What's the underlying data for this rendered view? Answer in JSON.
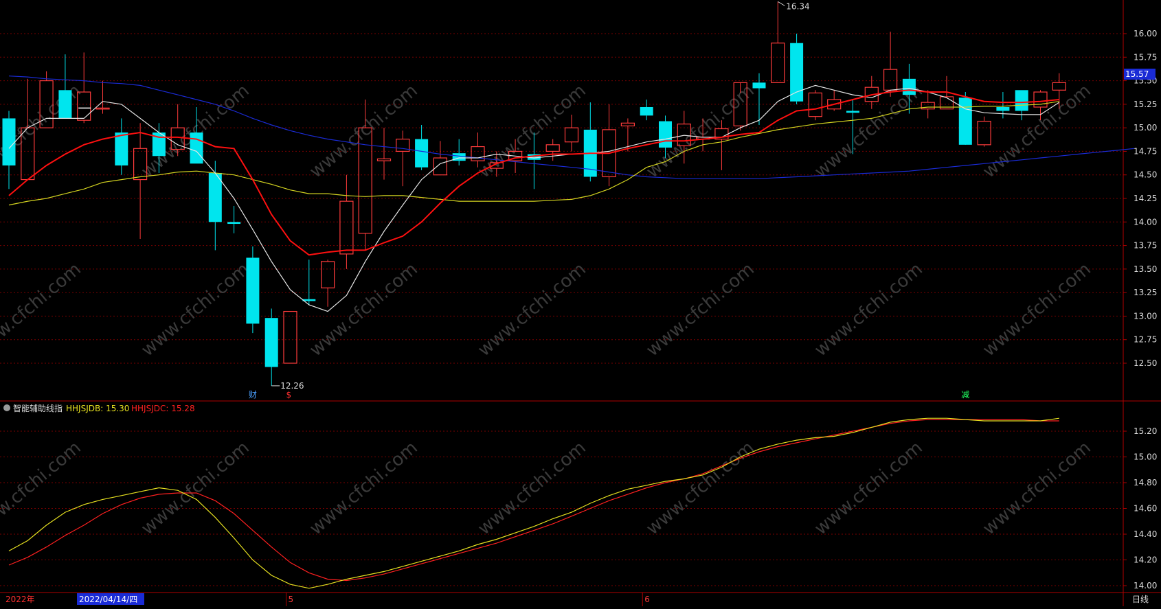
{
  "colors": {
    "background": "#000000",
    "grid": "#7a0000",
    "axis": "#b00000",
    "up": "#ff3b3b",
    "down": "#00e5ee",
    "ma5": "#e6e6e6",
    "ma10": "#ff1010",
    "ma20": "#d4d420",
    "ma60": "#1a2bd6",
    "sub_db": "#e6e020",
    "sub_dc": "#ff2020",
    "label_text": "#dcdcdc",
    "price_tag_bg": "#1a2bd6"
  },
  "price_panel": {
    "last_price_tag": "15.57",
    "high_label": "16.34",
    "low_label": "12.26",
    "markers": [
      {
        "text": "财",
        "color": "#4aa0ff",
        "index": 13
      },
      {
        "text": "$",
        "color": "#ff3030",
        "index": 15
      },
      {
        "text": "减",
        "color": "#20ff60",
        "index": 51
      }
    ]
  },
  "indicator": {
    "name": "智能辅助线指",
    "line1_label": "HHJSJDB: 15.30",
    "line2_label": "HHJSJDC: 15.28"
  },
  "bottom_axis": {
    "year_label": "2022年",
    "cursor_date": "2022/04/14/四",
    "month_labels": [
      {
        "text": "5",
        "index": 15
      },
      {
        "text": "6",
        "index": 34
      }
    ],
    "period_button": "日线"
  },
  "chart_data": [
    {
      "type": "candlestick",
      "ylim": [
        12.1,
        16.4
      ],
      "y_ticks": [
        "16.00",
        "15.75",
        "15.50",
        "15.25",
        "15.00",
        "14.75",
        "14.50",
        "14.25",
        "14.00",
        "13.75",
        "13.50",
        "13.25",
        "13.00",
        "12.75",
        "12.50"
      ],
      "ohlc": [
        [
          15.1,
          15.18,
          14.35,
          14.6
        ],
        [
          14.45,
          15.52,
          14.45,
          15.0
        ],
        [
          15.0,
          15.6,
          15.0,
          15.5
        ],
        [
          15.4,
          15.78,
          15.4,
          15.1
        ],
        [
          15.08,
          15.8,
          15.05,
          15.38
        ],
        [
          15.2,
          15.5,
          15.15,
          15.21
        ],
        [
          14.95,
          15.1,
          14.5,
          14.6
        ],
        [
          14.45,
          15.05,
          13.82,
          14.78
        ],
        [
          14.95,
          15.05,
          14.52,
          14.7
        ],
        [
          14.77,
          15.25,
          14.7,
          15.0
        ],
        [
          14.95,
          15.22,
          14.62,
          14.62
        ],
        [
          14.52,
          14.65,
          13.7,
          14.0
        ],
        [
          14.0,
          14.17,
          13.88,
          13.98
        ],
        [
          13.62,
          13.74,
          12.82,
          12.92
        ],
        [
          12.98,
          13.08,
          12.26,
          12.46
        ],
        [
          12.5,
          13.05,
          12.5,
          13.05
        ],
        [
          13.18,
          13.6,
          13.12,
          13.16
        ],
        [
          13.3,
          13.6,
          13.1,
          13.58
        ],
        [
          13.66,
          14.5,
          13.5,
          14.22
        ],
        [
          13.88,
          15.3,
          13.7,
          15.0
        ],
        [
          14.65,
          15.0,
          14.45,
          14.67
        ],
        [
          14.75,
          14.97,
          14.38,
          14.88
        ],
        [
          14.88,
          15.03,
          14.55,
          14.58
        ],
        [
          14.5,
          14.86,
          14.5,
          14.68
        ],
        [
          14.73,
          14.88,
          14.6,
          14.65
        ],
        [
          14.65,
          14.95,
          14.58,
          14.8
        ],
        [
          14.57,
          14.75,
          14.48,
          14.63
        ],
        [
          14.65,
          14.88,
          14.52,
          14.75
        ],
        [
          14.72,
          14.95,
          14.35,
          14.66
        ],
        [
          14.75,
          14.88,
          14.65,
          14.82
        ],
        [
          14.85,
          15.14,
          14.75,
          15.0
        ],
        [
          14.98,
          15.27,
          14.43,
          14.48
        ],
        [
          14.48,
          15.25,
          14.38,
          14.98
        ],
        [
          15.02,
          15.1,
          14.75,
          15.05
        ],
        [
          15.22,
          15.3,
          15.08,
          15.13
        ],
        [
          15.07,
          15.13,
          14.68,
          14.79
        ],
        [
          14.81,
          15.18,
          14.62,
          15.04
        ],
        [
          14.88,
          15.1,
          14.75,
          14.9
        ],
        [
          14.88,
          15.08,
          14.55,
          14.99
        ],
        [
          15.02,
          15.37,
          14.97,
          15.48
        ],
        [
          15.48,
          15.58,
          15.03,
          15.42
        ],
        [
          15.48,
          16.34,
          15.48,
          15.9
        ],
        [
          15.9,
          16.0,
          15.25,
          15.28
        ],
        [
          15.12,
          15.4,
          15.08,
          15.37
        ],
        [
          15.2,
          15.4,
          15.18,
          15.3
        ],
        [
          15.18,
          15.3,
          14.72,
          15.16
        ],
        [
          15.28,
          15.55,
          15.2,
          15.43
        ],
        [
          15.4,
          16.02,
          15.33,
          15.62
        ],
        [
          15.52,
          15.68,
          15.15,
          15.35
        ],
        [
          15.2,
          15.4,
          15.1,
          15.27
        ],
        [
          15.2,
          15.55,
          15.2,
          15.33
        ],
        [
          15.32,
          15.38,
          14.83,
          14.82
        ],
        [
          14.82,
          15.12,
          14.8,
          15.07
        ],
        [
          15.22,
          15.38,
          15.1,
          15.18
        ],
        [
          15.4,
          15.4,
          15.08,
          15.18
        ],
        [
          15.22,
          15.4,
          15.08,
          15.38
        ],
        [
          15.4,
          15.58,
          15.2,
          15.48
        ]
      ],
      "ma5": [
        14.78,
        15.0,
        15.1,
        15.1,
        15.1,
        15.28,
        15.25,
        15.1,
        14.95,
        14.82,
        14.75,
        14.52,
        14.25,
        13.92,
        13.58,
        13.28,
        13.12,
        13.05,
        13.22,
        13.58,
        13.9,
        14.18,
        14.45,
        14.62,
        14.68,
        14.68,
        14.72,
        14.7,
        14.68,
        14.7,
        14.72,
        14.73,
        14.75,
        14.8,
        14.85,
        14.88,
        14.92,
        14.9,
        14.9,
        15.0,
        15.08,
        15.28,
        15.38,
        15.45,
        15.4,
        15.35,
        15.32,
        15.4,
        15.42,
        15.38,
        15.32,
        15.2,
        15.16,
        15.15,
        15.14,
        15.14,
        15.27
      ],
      "ma10": [
        14.28,
        14.45,
        14.6,
        14.72,
        14.82,
        14.88,
        14.92,
        14.95,
        14.9,
        14.9,
        14.88,
        14.8,
        14.78,
        14.45,
        14.08,
        13.8,
        13.65,
        13.68,
        13.7,
        13.7,
        13.78,
        13.85,
        14.0,
        14.2,
        14.38,
        14.52,
        14.62,
        14.68,
        14.7,
        14.72,
        14.72,
        14.73,
        14.73,
        14.78,
        14.82,
        14.86,
        14.86,
        14.88,
        14.9,
        14.93,
        14.95,
        15.08,
        15.18,
        15.2,
        15.25,
        15.3,
        15.35,
        15.38,
        15.4,
        15.38,
        15.38,
        15.33,
        15.28,
        15.27,
        15.27,
        15.28,
        15.3
      ],
      "ma20": [
        14.18,
        14.22,
        14.25,
        14.3,
        14.35,
        14.42,
        14.45,
        14.48,
        14.5,
        14.53,
        14.54,
        14.52,
        14.5,
        14.45,
        14.4,
        14.34,
        14.3,
        14.3,
        14.28,
        14.27,
        14.28,
        14.28,
        14.26,
        14.24,
        14.22,
        14.22,
        14.22,
        14.22,
        14.22,
        14.23,
        14.24,
        14.28,
        14.35,
        14.45,
        14.58,
        14.64,
        14.75,
        14.82,
        14.85,
        14.9,
        14.94,
        14.98,
        15.01,
        15.04,
        15.06,
        15.08,
        15.1,
        15.15,
        15.2,
        15.22,
        15.22,
        15.22,
        15.23,
        15.23,
        15.24,
        15.25,
        15.28
      ],
      "ma60": [
        15.55,
        15.54,
        15.52,
        15.51,
        15.5,
        15.48,
        15.47,
        15.45,
        15.4,
        15.35,
        15.3,
        15.25,
        15.18,
        15.1,
        15.03,
        14.97,
        14.92,
        14.88,
        14.85,
        14.82,
        14.8,
        14.78,
        14.75,
        14.72,
        14.7,
        14.68,
        14.66,
        14.64,
        14.62,
        14.6,
        14.58,
        14.56,
        14.53,
        14.5,
        14.48,
        14.47,
        14.46,
        14.46,
        14.46,
        14.46,
        14.46,
        14.47,
        14.48,
        14.49,
        14.5,
        14.51,
        14.52,
        14.53,
        14.54,
        14.56,
        14.58,
        14.6,
        14.62,
        14.64,
        14.66,
        14.68,
        14.7,
        14.72,
        14.74,
        14.76,
        14.78
      ]
    },
    {
      "type": "line",
      "title": "智能辅助线指",
      "ylim": [
        13.96,
        15.36
      ],
      "y_ticks": [
        "15.20",
        "15.00",
        "14.80",
        "14.60",
        "14.40",
        "14.20",
        "14.00"
      ],
      "series": [
        {
          "name": "HHJSJDB",
          "values": [
            14.27,
            14.35,
            14.47,
            14.57,
            14.63,
            14.67,
            14.7,
            14.73,
            14.76,
            14.74,
            14.67,
            14.53,
            14.37,
            14.2,
            14.08,
            14.01,
            13.98,
            14.01,
            14.05,
            14.08,
            14.11,
            14.15,
            14.19,
            14.23,
            14.27,
            14.32,
            14.36,
            14.41,
            14.46,
            14.52,
            14.57,
            14.64,
            14.7,
            14.75,
            14.78,
            14.81,
            14.83,
            14.86,
            14.92,
            15.0,
            15.06,
            15.1,
            15.13,
            15.15,
            15.16,
            15.19,
            15.23,
            15.27,
            15.29,
            15.3,
            15.3,
            15.29,
            15.28,
            15.28,
            15.28,
            15.28,
            15.3
          ]
        },
        {
          "name": "HHJSJDC",
          "values": [
            14.16,
            14.22,
            14.3,
            14.39,
            14.47,
            14.56,
            14.63,
            14.68,
            14.71,
            14.72,
            14.72,
            14.66,
            14.56,
            14.43,
            14.3,
            14.18,
            14.1,
            14.05,
            14.04,
            14.06,
            14.09,
            14.13,
            14.17,
            14.21,
            14.25,
            14.29,
            14.33,
            14.38,
            14.43,
            14.48,
            14.54,
            14.6,
            14.66,
            14.71,
            14.76,
            14.8,
            14.83,
            14.87,
            14.93,
            14.99,
            15.04,
            15.08,
            15.11,
            15.14,
            15.17,
            15.2,
            15.23,
            15.26,
            15.28,
            15.29,
            15.29,
            15.29,
            15.29,
            15.29,
            15.29,
            15.28,
            15.28
          ]
        }
      ]
    }
  ]
}
